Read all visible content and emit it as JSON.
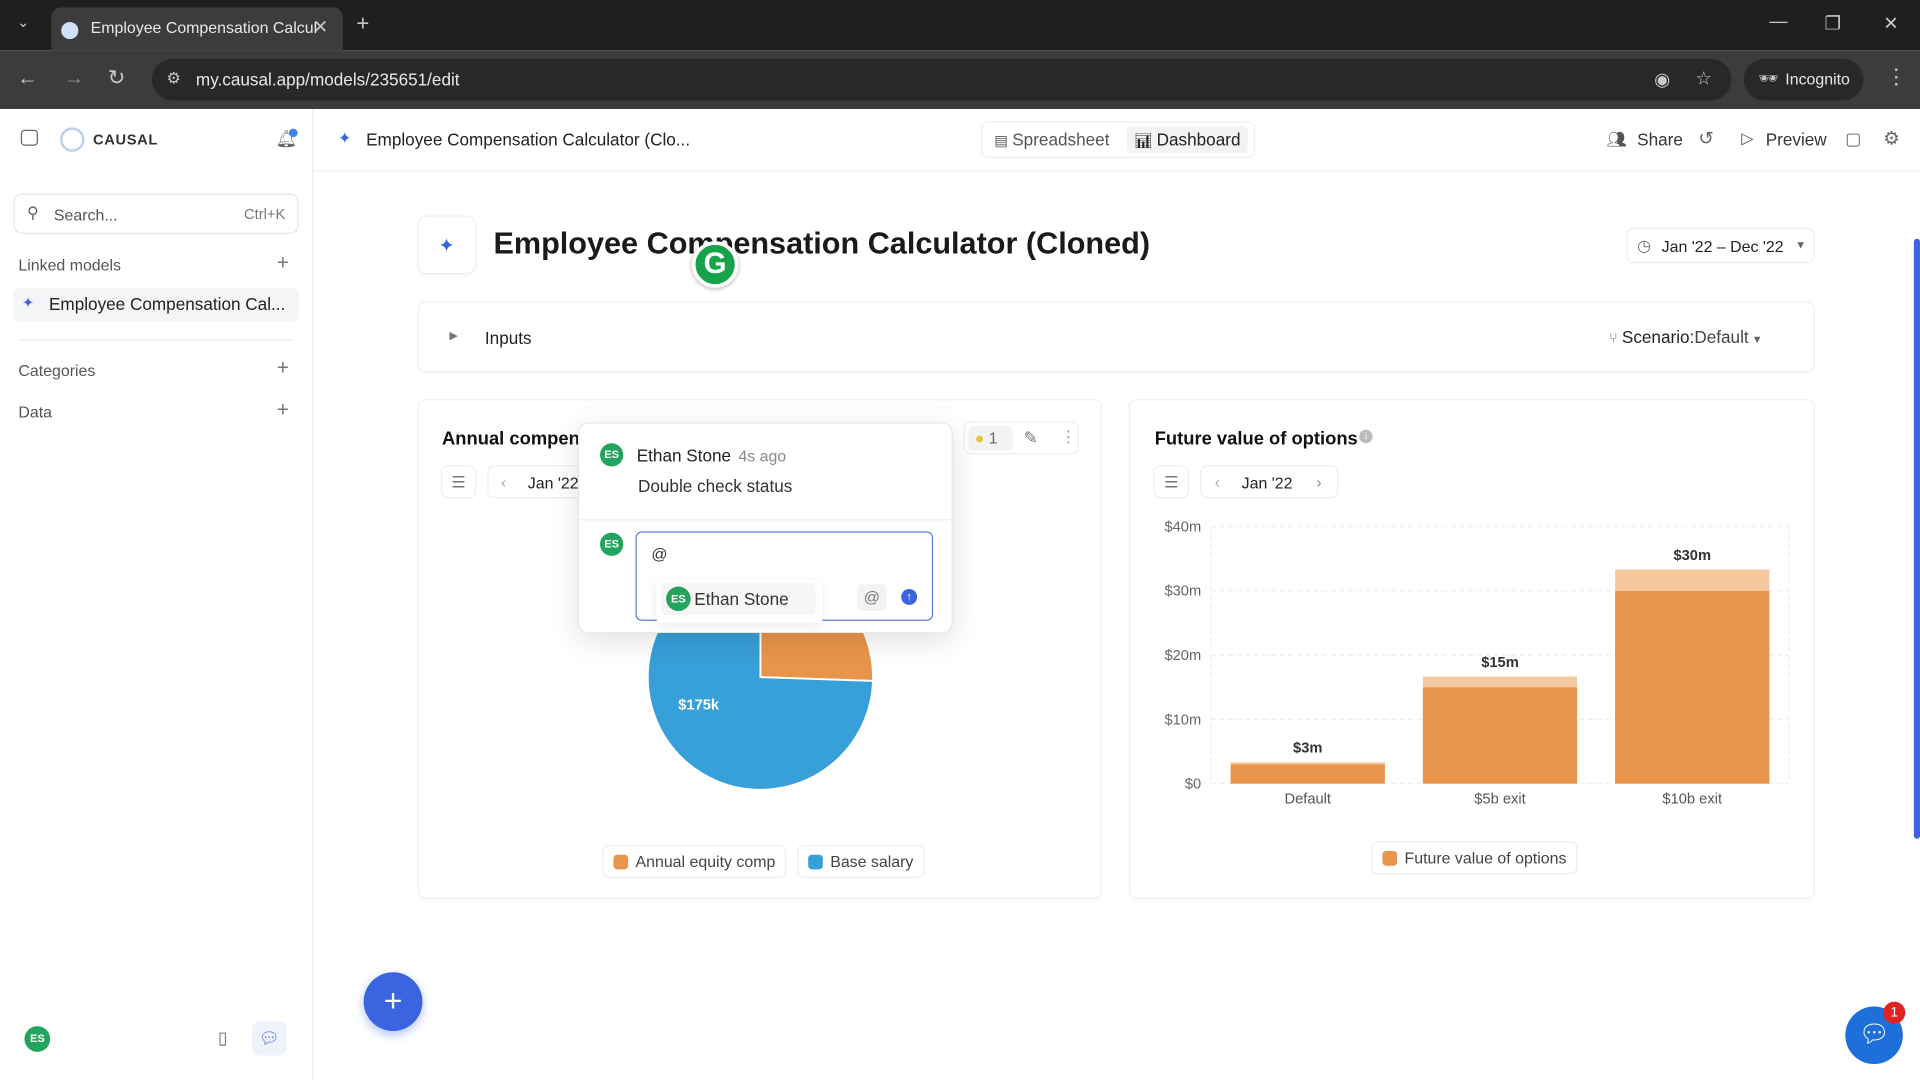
{
  "browser": {
    "tab_title": "Employee Compensation Calcul",
    "url": "my.causal.app/models/235651/edit",
    "incognito_label": "Incognito"
  },
  "sidebar": {
    "brand": "CAUSAL",
    "search_placeholder": "Search...",
    "search_shortcut": "Ctrl+K",
    "linked_models_label": "Linked models",
    "linked_model_item": "Employee Compensation Cal...",
    "categories_label": "Categories",
    "data_label": "Data",
    "user_initials": "ES"
  },
  "header": {
    "model_title": "Employee Compensation Calculator (Clo...",
    "spreadsheet_label": "Spreadsheet",
    "dashboard_label": "Dashboard",
    "share_label": "Share",
    "preview_label": "Preview"
  },
  "page": {
    "title": "Employee Compensation Calculator (Cloned)",
    "date_range": "Jan '22 – Dec '22",
    "inputs_label": "Inputs",
    "scenario_label": "Scenario:",
    "scenario_value": "Default"
  },
  "pie_card": {
    "title": "Annual compens",
    "period": "Jan '22",
    "comment_count": "1"
  },
  "bar_card": {
    "title": "Future value of options",
    "period": "Jan '22"
  },
  "comment": {
    "author": "Ethan Stone",
    "time": "4s ago",
    "text": "Double check status",
    "initials": "ES",
    "input_value": "@",
    "mention_suggestion": "Ethan Stone"
  },
  "colors": {
    "orange": "#e8954b",
    "orange_light": "#f4c9a0",
    "blue": "#38a0d8",
    "green": "#22a45d",
    "accent": "#3b64e0"
  },
  "chat_badge": "1",
  "chart_data": [
    {
      "type": "pie",
      "slices": [
        {
          "name": "Annual equity comp",
          "value": 60,
          "color": "#e8954b"
        },
        {
          "name": "Base salary",
          "value": 175,
          "label": "$175k",
          "color": "#38a0d8"
        }
      ],
      "legend": "bottom"
    },
    {
      "type": "bar",
      "title": "Future value of options",
      "categories": [
        "Default",
        "$5b exit",
        "$10b exit"
      ],
      "values": [
        3,
        15,
        30
      ],
      "data_labels": [
        "$3m",
        "$15m",
        "$30m"
      ],
      "yticks": [
        "$0",
        "$10m",
        "$20m",
        "$30m",
        "$40m"
      ],
      "ylim": [
        0,
        40
      ],
      "series": [
        {
          "name": "Future value of options",
          "color": "#e8954b"
        }
      ],
      "grid": true,
      "legend": "bottom"
    }
  ]
}
